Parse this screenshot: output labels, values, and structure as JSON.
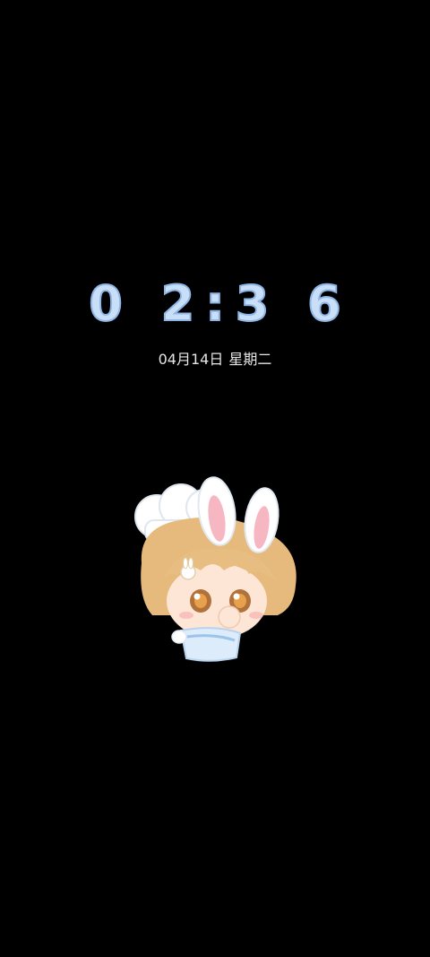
{
  "lockscreen": {
    "time": "0 2:3 6",
    "date": "04月14日",
    "weekday": "星期二"
  },
  "colors": {
    "background": "#000000",
    "clock_fill": "#c9def7",
    "clock_outline": "#8fb7e6",
    "date_text": "#e6e6e6"
  },
  "mascot": {
    "icon": "bunny-chef-character-sticker"
  }
}
